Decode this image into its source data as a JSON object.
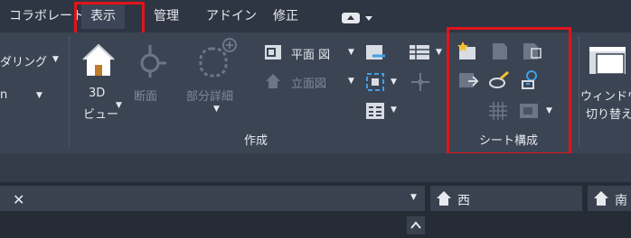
{
  "tabs": [
    "コラボレート",
    "表示",
    "管理",
    "アドイン",
    "修正"
  ],
  "active_tab": "表示",
  "ribbon": {
    "render_label": "ダリング",
    "left_cut_label": "n",
    "view3d_label_line1": "3D",
    "view3d_label_line2": "ビュー",
    "section_label": "断面",
    "detail_label": "部分詳細",
    "plan_label": "平面 図",
    "elevation_label": "立面図",
    "create_panel_label": "作成",
    "sheet_panel_label": "シート構成",
    "window_label_line1": "ウィンドウ",
    "window_label_line2": "切り替え"
  },
  "panes": {
    "close_glyph": "✕",
    "west_label": "西",
    "south_label": "南"
  },
  "colors": {
    "highlight": "#e0141b",
    "ribbon_bg": "#3b4453",
    "tabbar_bg": "#2f3643"
  }
}
